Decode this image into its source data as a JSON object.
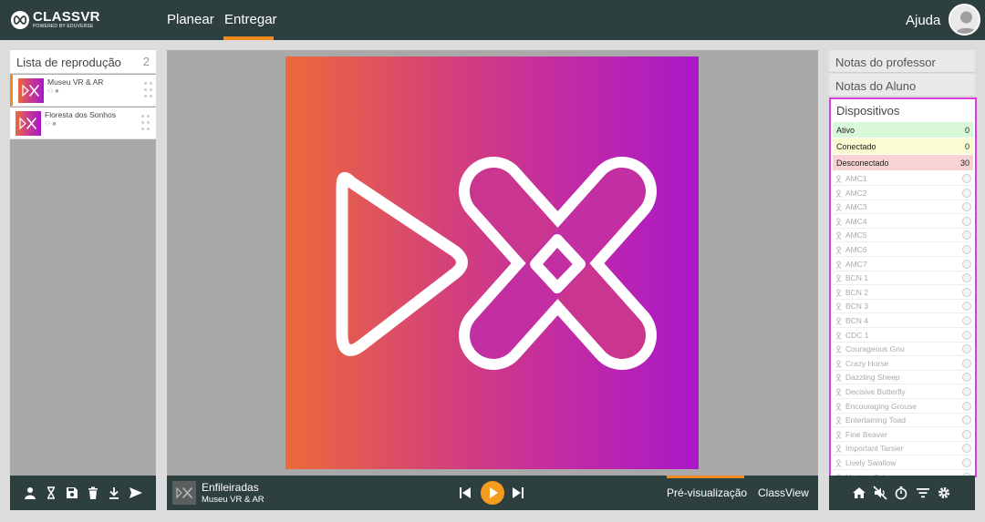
{
  "app": {
    "brand": "CLASSVR",
    "tagline": "POWERED BY EDUVERSE",
    "accent_color": "#f08a1c",
    "topbar_color": "#2d3f3f",
    "highlight_color": "#d83fdc"
  },
  "nav": {
    "items": [
      {
        "label": "Planear"
      },
      {
        "label": "Entregar",
        "active": true
      }
    ],
    "help_label": "Ajuda"
  },
  "playlist": {
    "title": "Lista de reprodução",
    "count": "2",
    "items": [
      {
        "name": "Museu VR & AR",
        "active": true
      },
      {
        "name": "Floresta dos Sonhos",
        "active": false
      }
    ],
    "toolbar_icons": [
      "user-icon",
      "hourglass-icon",
      "save-icon",
      "trash-icon",
      "download-icon",
      "send-icon"
    ]
  },
  "player": {
    "title": "Enfileiradas",
    "subtitle": "Museu VR & AR",
    "controls": [
      "skip-previous-icon",
      "play-icon",
      "skip-next-icon"
    ],
    "modes": [
      {
        "label": "Pré-visualização",
        "active": true
      },
      {
        "label": "ClassView",
        "active": false
      }
    ]
  },
  "right_panel": {
    "tabs": [
      "Notas do professor",
      "Notas do Aluno"
    ],
    "devices_title": "Dispositivos",
    "stats": [
      {
        "label": "Ativo",
        "value": "0",
        "color": "#d9f7d9"
      },
      {
        "label": "Conectado",
        "value": "0",
        "color": "#fbfbd2"
      },
      {
        "label": "Desconectado",
        "value": "30",
        "color": "#f8d3d3"
      }
    ],
    "devices": [
      "AMC1",
      "AMC2",
      "AMC3",
      "AMC4",
      "AMC5",
      "AMC6",
      "AMC7",
      "BCN 1",
      "BCN 2",
      "BCN 3",
      "BCN 4",
      "CDC 1",
      "Courageous Gnu",
      "Crazy Horse",
      "Dazzling Sheep",
      "Decisive Butterfly",
      "Encouraging Grouse",
      "Entertaining Toad",
      "Fine Beaver",
      "Important Tarsier",
      "Lively Swallow",
      "Modern Zebra"
    ],
    "toolbar_icons": [
      "home-icon",
      "mute-icon",
      "timer-icon",
      "filter-icon",
      "settings-icon"
    ]
  }
}
